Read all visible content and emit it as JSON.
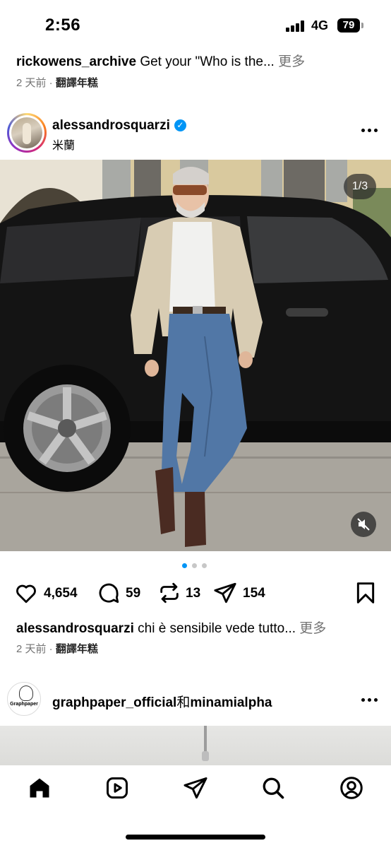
{
  "status_bar": {
    "time": "2:56",
    "network": "4G",
    "battery": "79"
  },
  "prev_post": {
    "username": "rickowens_archive",
    "caption_text": " Get your \"Who is the...",
    "more": " 更多",
    "time": "2 天前",
    "dot": " · ",
    "translate": "翻譯年糕"
  },
  "post": {
    "username": "alessandrosquarzi",
    "verified_icon": "✓",
    "location": "米蘭",
    "counter": "1/3",
    "likes": "4,654",
    "comments": "59",
    "reposts": "13",
    "shares": "154",
    "caption_user": "alessandrosquarzi",
    "caption_text": " chi è sensibile vede tutto...",
    "more": " 更多",
    "time": "2 天前",
    "dot": " · ",
    "translate": "翻譯年糕",
    "carousel": {
      "count": 3,
      "active": 0
    }
  },
  "next_post": {
    "user1": "graphpaper_official",
    "conj": "和",
    "user2": "minamialpha",
    "avatar_text": "Graphpaper"
  },
  "icons": {
    "like": "heart-icon",
    "comment": "comment-icon",
    "repost": "repost-icon",
    "share": "send-icon",
    "save": "bookmark-icon",
    "mute": "muted-speaker-icon",
    "nav": [
      "home-icon",
      "reels-icon",
      "send-icon",
      "search-icon",
      "profile-icon"
    ]
  },
  "colors": {
    "verified": "#0095f6",
    "secondary_text": "#737373",
    "active_dot": "#0095f6"
  }
}
